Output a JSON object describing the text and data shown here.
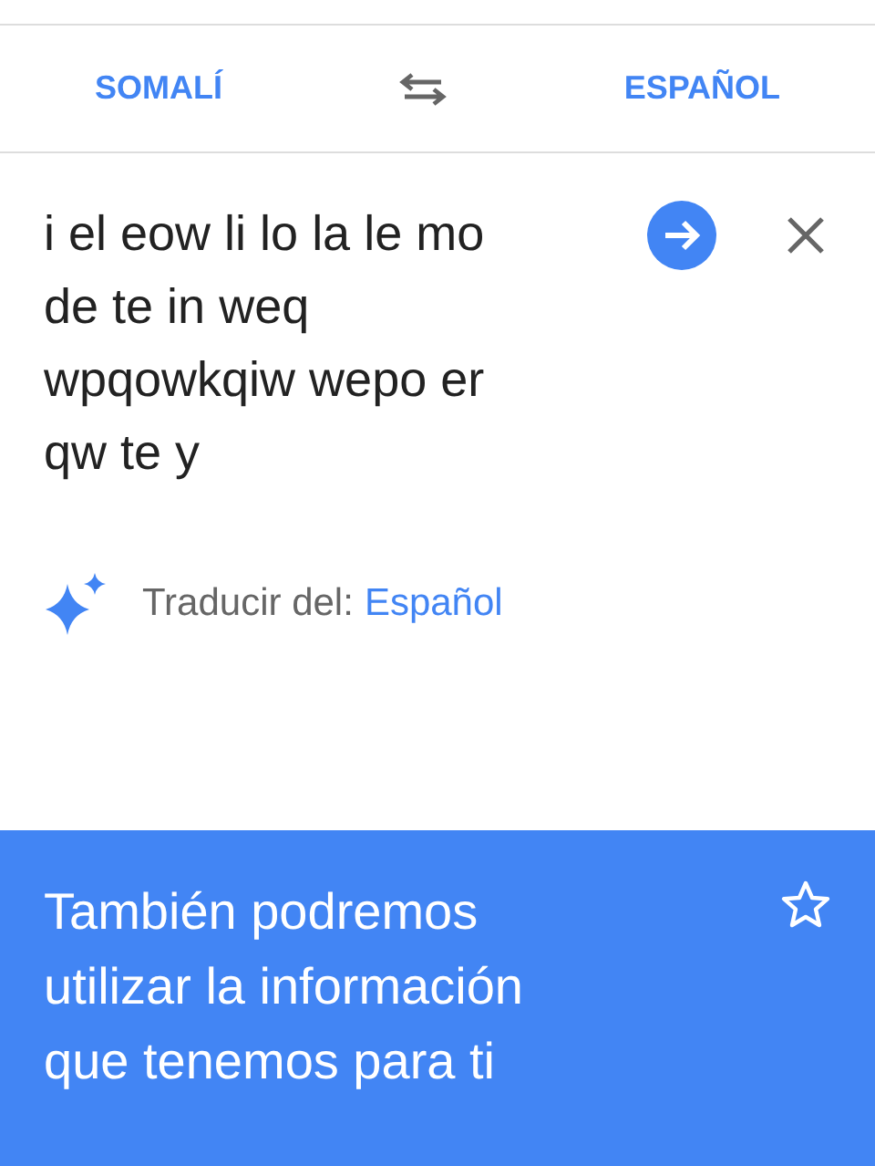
{
  "languages": {
    "source": "SOMALÍ",
    "target": "ESPAÑOL"
  },
  "input": {
    "value": "i el eow li lo la le mo de te in weq wpqowkqiw wepo er qw te y"
  },
  "suggestion": {
    "label": "Traducir del:",
    "language": "Español"
  },
  "translation": {
    "text": "También podremos utilizar la información que tenemos para ti",
    "starred": false
  }
}
